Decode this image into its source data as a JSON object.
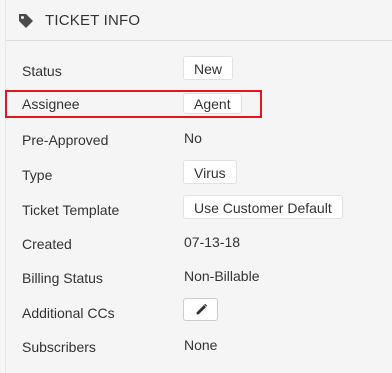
{
  "header": {
    "title": "TICKET INFO",
    "icon": "tag-icon"
  },
  "fields": [
    {
      "label": "Status",
      "value": "New",
      "kind": "pill"
    },
    {
      "label": "Assignee",
      "value": "Agent",
      "kind": "pill"
    },
    {
      "label": "Pre-Approved",
      "value": "No",
      "kind": "text"
    },
    {
      "label": "Type",
      "value": "Virus",
      "kind": "pill"
    },
    {
      "label": "Ticket Template",
      "value": "Use Customer Default",
      "kind": "pill"
    },
    {
      "label": "Created",
      "value": "07-13-18",
      "kind": "text"
    },
    {
      "label": "Billing Status",
      "value": "Non-Billable",
      "kind": "text"
    },
    {
      "label": "Additional CCs",
      "value": "",
      "kind": "edit-button",
      "icon": "pencil-icon"
    },
    {
      "label": "Subscribers",
      "value": "None",
      "kind": "text"
    }
  ],
  "highlight": {
    "target": "Assignee",
    "color": "#e3161d"
  }
}
